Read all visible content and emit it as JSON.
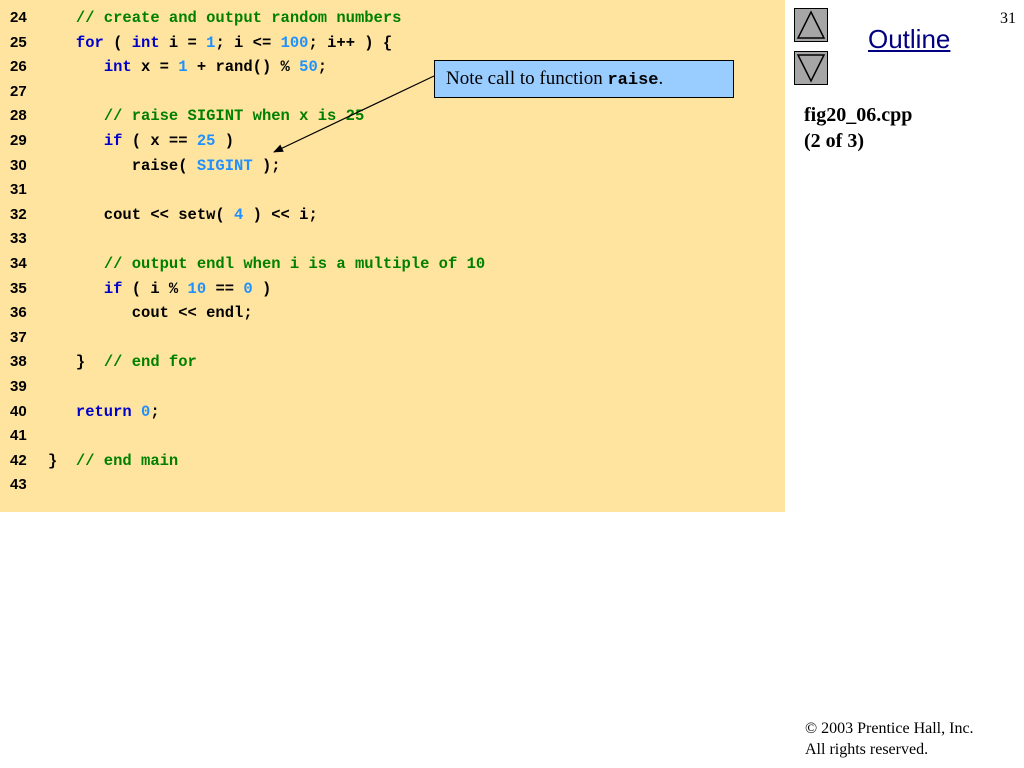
{
  "slide": {
    "number": "31",
    "outline_label": "Outline",
    "file_title": "fig20_06.cpp",
    "file_part": "(2 of 3)",
    "copyright_line1": "© 2003 Prentice Hall, Inc.",
    "copyright_line2": "All rights reserved.",
    "up_icon": "triangle-up-icon",
    "down_icon": "triangle-down-icon"
  },
  "callout": {
    "prefix": "Note call to function ",
    "function_name": "raise",
    "suffix": "."
  },
  "colors": {
    "code_background": "#ffe49f",
    "keyword": "#0000cc",
    "comment": "#008000",
    "number": "#1e90ff",
    "callout_background": "#99ccff",
    "outline_link": "#000080",
    "nav_button": "#a6a6a6"
  },
  "code": {
    "lines": [
      {
        "num": "24",
        "segments": [
          {
            "t": "   ",
            "c": "tx"
          },
          {
            "t": "// create and output random numbers",
            "c": "cm"
          }
        ]
      },
      {
        "num": "25",
        "segments": [
          {
            "t": "   ",
            "c": "tx"
          },
          {
            "t": "for",
            "c": "kw"
          },
          {
            "t": " ( ",
            "c": "tx"
          },
          {
            "t": "int",
            "c": "kw"
          },
          {
            "t": " i = ",
            "c": "tx"
          },
          {
            "t": "1",
            "c": "num"
          },
          {
            "t": "; i <= ",
            "c": "tx"
          },
          {
            "t": "100",
            "c": "num"
          },
          {
            "t": "; i++ ) {",
            "c": "tx"
          }
        ]
      },
      {
        "num": "26",
        "segments": [
          {
            "t": "      ",
            "c": "tx"
          },
          {
            "t": "int",
            "c": "kw"
          },
          {
            "t": " x = ",
            "c": "tx"
          },
          {
            "t": "1",
            "c": "num"
          },
          {
            "t": " + rand() % ",
            "c": "tx"
          },
          {
            "t": "50",
            "c": "num"
          },
          {
            "t": ";",
            "c": "tx"
          }
        ]
      },
      {
        "num": "27",
        "segments": []
      },
      {
        "num": "28",
        "segments": [
          {
            "t": "      ",
            "c": "tx"
          },
          {
            "t": "// raise SIGINT when x is 25",
            "c": "cm"
          }
        ]
      },
      {
        "num": "29",
        "segments": [
          {
            "t": "      ",
            "c": "tx"
          },
          {
            "t": "if",
            "c": "kw"
          },
          {
            "t": " ( x == ",
            "c": "tx"
          },
          {
            "t": "25",
            "c": "num"
          },
          {
            "t": " )",
            "c": "tx"
          }
        ]
      },
      {
        "num": "30",
        "segments": [
          {
            "t": "         raise( ",
            "c": "tx"
          },
          {
            "t": "SIGINT",
            "c": "num"
          },
          {
            "t": " );",
            "c": "tx"
          }
        ]
      },
      {
        "num": "31",
        "segments": []
      },
      {
        "num": "32",
        "segments": [
          {
            "t": "      cout << setw( ",
            "c": "tx"
          },
          {
            "t": "4",
            "c": "num"
          },
          {
            "t": " ) << i;",
            "c": "tx"
          }
        ]
      },
      {
        "num": "33",
        "segments": []
      },
      {
        "num": "34",
        "segments": [
          {
            "t": "      ",
            "c": "tx"
          },
          {
            "t": "// output endl when i is a multiple of 10",
            "c": "cm"
          }
        ]
      },
      {
        "num": "35",
        "segments": [
          {
            "t": "      ",
            "c": "tx"
          },
          {
            "t": "if",
            "c": "kw"
          },
          {
            "t": " ( i % ",
            "c": "tx"
          },
          {
            "t": "10",
            "c": "num"
          },
          {
            "t": " == ",
            "c": "tx"
          },
          {
            "t": "0",
            "c": "num"
          },
          {
            "t": " )",
            "c": "tx"
          }
        ]
      },
      {
        "num": "36",
        "segments": [
          {
            "t": "         cout << endl;",
            "c": "tx"
          }
        ]
      },
      {
        "num": "37",
        "segments": []
      },
      {
        "num": "38",
        "segments": [
          {
            "t": "   }  ",
            "c": "tx"
          },
          {
            "t": "// end for",
            "c": "cm"
          }
        ]
      },
      {
        "num": "39",
        "segments": []
      },
      {
        "num": "40",
        "segments": [
          {
            "t": "   ",
            "c": "tx"
          },
          {
            "t": "return",
            "c": "kw"
          },
          {
            "t": " ",
            "c": "tx"
          },
          {
            "t": "0",
            "c": "num"
          },
          {
            "t": ";",
            "c": "tx"
          }
        ]
      },
      {
        "num": "41",
        "segments": []
      },
      {
        "num": "42",
        "segments": [
          {
            "t": "}  ",
            "c": "tx"
          },
          {
            "t": "// end main",
            "c": "cm"
          }
        ]
      },
      {
        "num": "43",
        "segments": []
      }
    ]
  }
}
